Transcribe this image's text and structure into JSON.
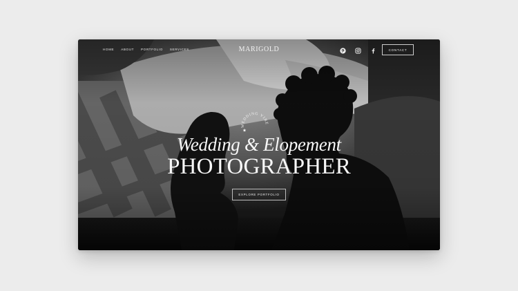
{
  "nav": {
    "links": [
      "HOME",
      "ABOUT",
      "PORTFOLIO",
      "SERVICES"
    ]
  },
  "brand": {
    "logo_text": "MARIGOLD"
  },
  "social": {
    "icons": [
      "pinterest-icon",
      "instagram-icon",
      "facebook-icon"
    ]
  },
  "header": {
    "contact_label": "CONTACT"
  },
  "hero": {
    "badge_text": "WEDDING VIBES",
    "script_line": "Wedding & Elopement",
    "title_line": "PHOTOGRAPHER",
    "cta_label": "EXPLORE PORTFOLIO"
  },
  "colors": {
    "page_background": "#ececec",
    "hero_background": "#0d0d0d",
    "text": "#f7f7f7"
  }
}
